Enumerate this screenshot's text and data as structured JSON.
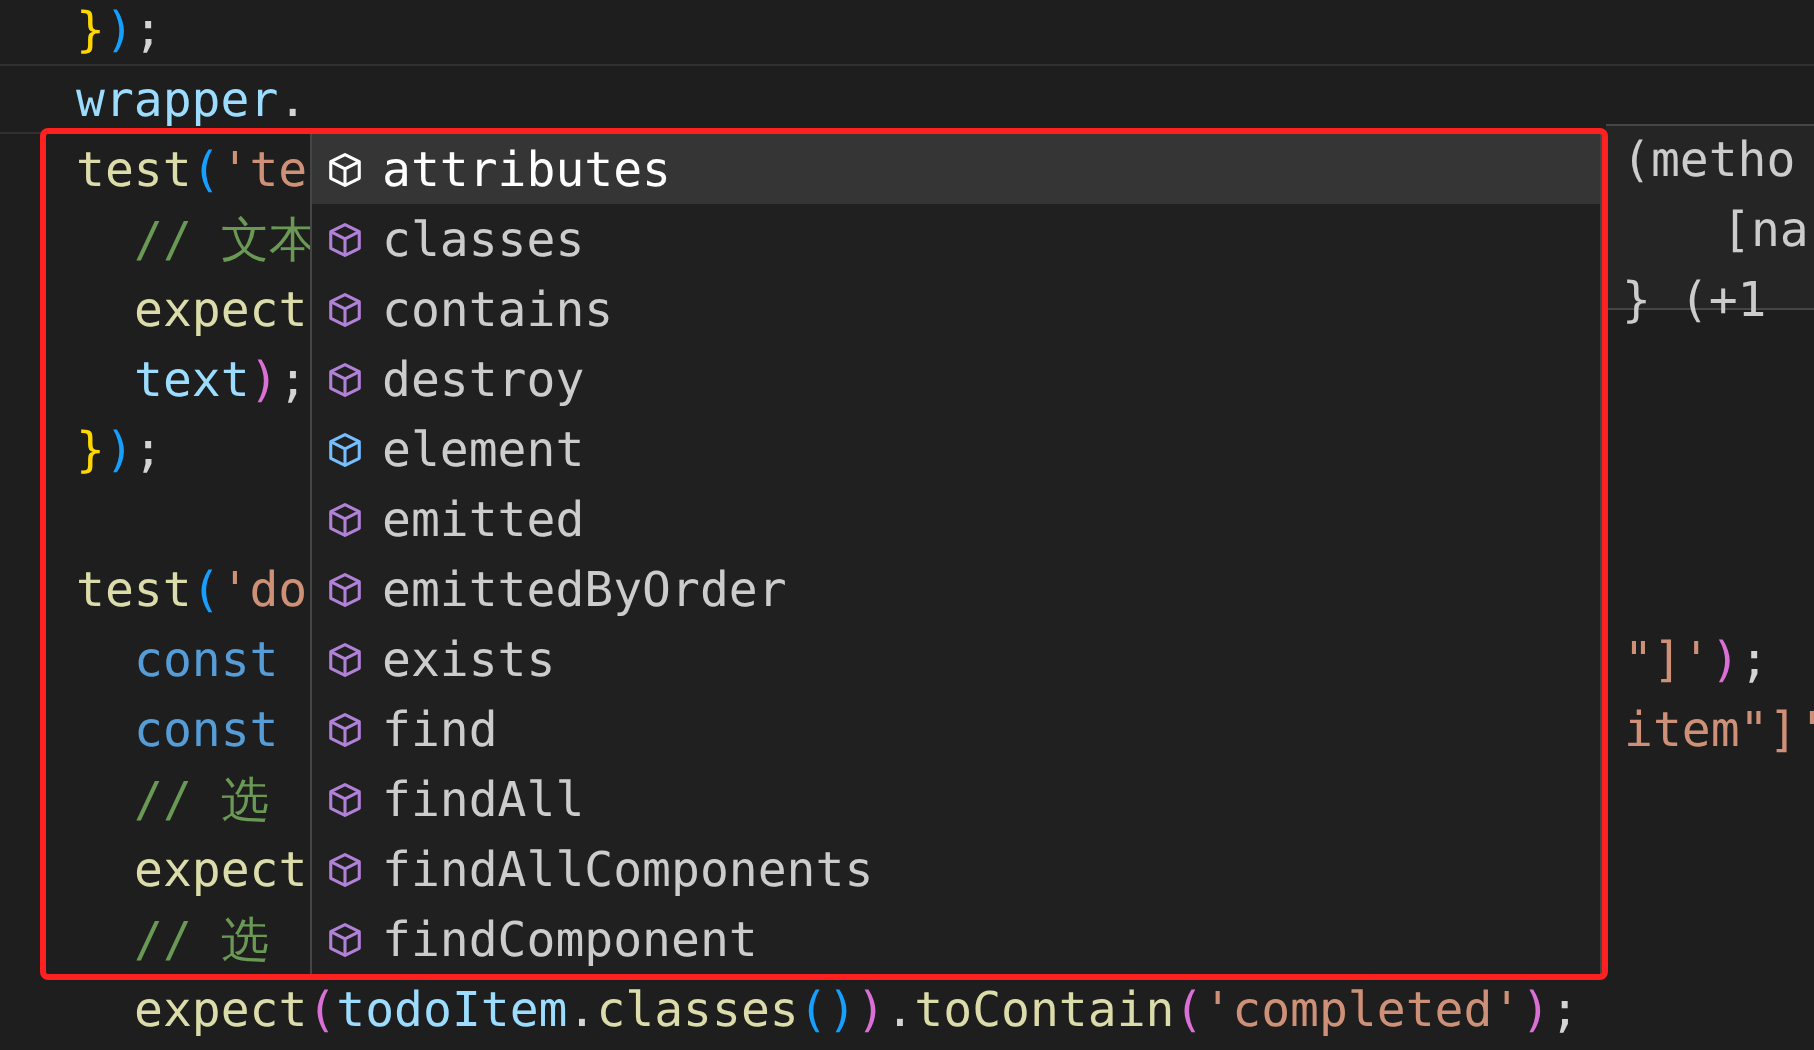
{
  "code_lines": [
    {
      "current": false,
      "tokens": [
        {
          "text": "}",
          "kind": "brace"
        },
        {
          "text": ")",
          "kind": "paren"
        },
        {
          "text": ";",
          "kind": "punct"
        }
      ]
    },
    {
      "current": true,
      "tokens": [
        {
          "text": "wrapper",
          "kind": "variable"
        },
        {
          "text": ".",
          "kind": "punct"
        }
      ]
    },
    {
      "current": false,
      "tokens": [
        {
          "text": "test",
          "kind": "function"
        },
        {
          "text": "(",
          "kind": "paren"
        },
        {
          "text": "'te",
          "kind": "string"
        }
      ],
      "children": [
        {
          "current": false,
          "tokens": [
            {
              "text": "// 文本",
              "kind": "comment"
            }
          ]
        },
        {
          "current": false,
          "tokens": [
            {
              "text": "expect",
              "kind": "function"
            }
          ]
        },
        {
          "current": false,
          "tokens": [
            {
              "text": "text",
              "kind": "variable"
            },
            {
              "text": ")",
              "kind": "paren2"
            },
            {
              "text": ";",
              "kind": "punct"
            }
          ]
        }
      ]
    },
    {
      "current": false,
      "tokens": [
        {
          "text": "}",
          "kind": "brace"
        },
        {
          "text": ")",
          "kind": "paren"
        },
        {
          "text": ";",
          "kind": "punct"
        }
      ]
    },
    {
      "current": false
    },
    {
      "current": false,
      "tokens": [
        {
          "text": "test",
          "kind": "function"
        },
        {
          "text": "(",
          "kind": "paren"
        },
        {
          "text": "'do",
          "kind": "string"
        }
      ],
      "children": [
        {
          "current": false,
          "tokens": [
            {
              "text": "const",
              "kind": "keyword"
            }
          ],
          "tail": [
            {
              "text": "\"]'",
              "kind": "string"
            },
            {
              "text": ")",
              "kind": "paren2"
            },
            {
              "text": ";",
              "kind": "punct"
            }
          ]
        },
        {
          "current": false,
          "tokens": [
            {
              "text": "const",
              "kind": "keyword"
            }
          ],
          "tail": [
            {
              "text": "item\"]'",
              "kind": "string"
            }
          ]
        },
        {
          "current": false,
          "tokens": [
            {
              "text": "// 选",
              "kind": "comment"
            }
          ]
        },
        {
          "current": false,
          "tokens": [
            {
              "text": "expect",
              "kind": "function"
            }
          ]
        },
        {
          "current": false,
          "tokens": [
            {
              "text": "// 选",
              "kind": "comment"
            }
          ]
        },
        {
          "current": false,
          "tokens": [
            {
              "text": "expect",
              "kind": "function"
            },
            {
              "text": "(",
              "kind": "paren2"
            },
            {
              "text": "todoItem",
              "kind": "variable"
            },
            {
              "text": ".",
              "kind": "punct"
            },
            {
              "text": "classes",
              "kind": "function"
            },
            {
              "text": "()",
              "kind": "paren"
            },
            {
              "text": ")",
              "kind": "paren2"
            },
            {
              "text": ".",
              "kind": "punct"
            },
            {
              "text": "toContain",
              "kind": "function"
            },
            {
              "text": "(",
              "kind": "paren2"
            },
            {
              "text": "'completed'",
              "kind": "string"
            },
            {
              "text": ")",
              "kind": "paren2"
            },
            {
              "text": ";",
              "kind": "punct"
            }
          ]
        }
      ]
    }
  ],
  "hover_tooltip": {
    "lines": [
      {
        "text": "(metho",
        "kind": "head"
      },
      {
        "text": "[na",
        "kind": "indented"
      },
      {
        "text": "} (+1",
        "kind": "head"
      }
    ]
  },
  "suggestions": [
    {
      "label": "attributes",
      "kind": "method",
      "selected": true
    },
    {
      "label": "classes",
      "kind": "method",
      "selected": false
    },
    {
      "label": "contains",
      "kind": "method",
      "selected": false
    },
    {
      "label": "destroy",
      "kind": "method",
      "selected": false
    },
    {
      "label": "element",
      "kind": "field",
      "selected": false
    },
    {
      "label": "emitted",
      "kind": "method",
      "selected": false
    },
    {
      "label": "emittedByOrder",
      "kind": "method",
      "selected": false
    },
    {
      "label": "exists",
      "kind": "method",
      "selected": false
    },
    {
      "label": "find",
      "kind": "method",
      "selected": false
    },
    {
      "label": "findAll",
      "kind": "method",
      "selected": false
    },
    {
      "label": "findAllComponents",
      "kind": "method",
      "selected": false
    },
    {
      "label": "findComponent",
      "kind": "method",
      "selected": false
    }
  ]
}
